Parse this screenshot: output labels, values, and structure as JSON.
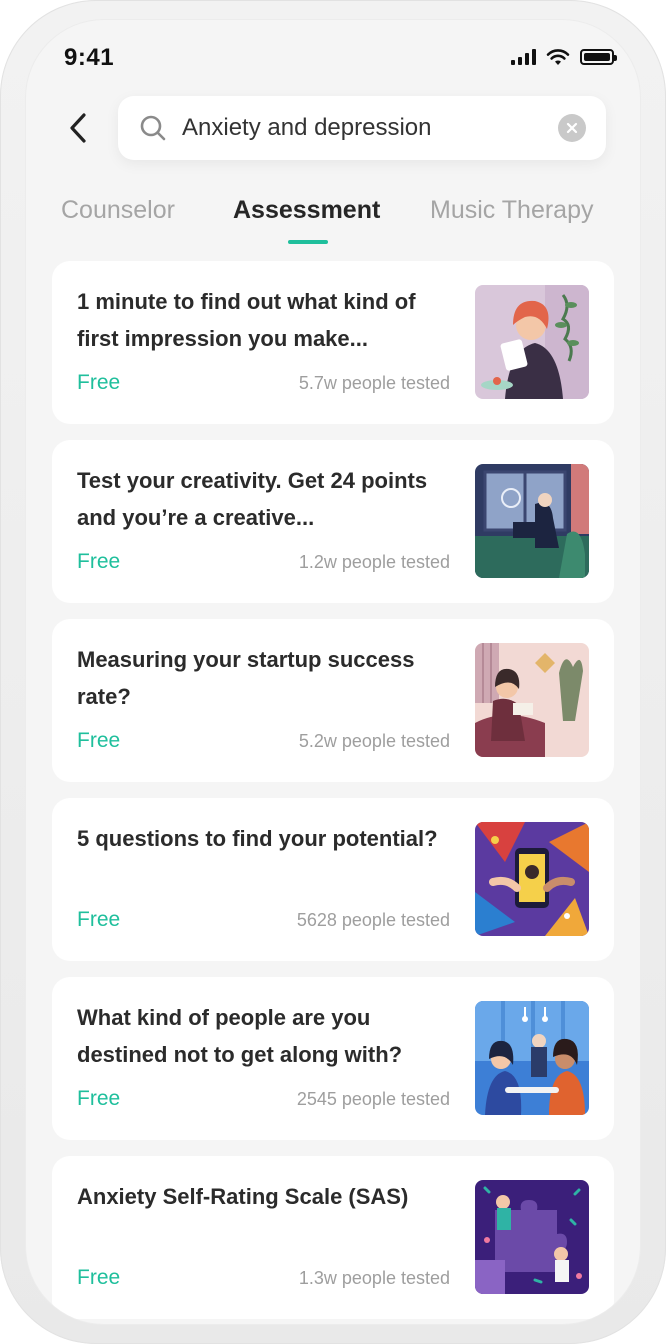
{
  "status_bar": {
    "time": "9:41"
  },
  "search": {
    "value": "Anxiety and depression"
  },
  "tabs": [
    {
      "label": "Counselor",
      "active": false
    },
    {
      "label": "Assessment",
      "active": true
    },
    {
      "label": "Music Therapy",
      "active": false
    }
  ],
  "colors": {
    "accent": "#1fbf9c",
    "muted_text": "#9e9e9e",
    "background": "#f5f5f5"
  },
  "assessments": [
    {
      "title": "1 minute to find out what kind of first impression you make...",
      "price": "Free",
      "tested": "5.7w people tested",
      "image": "woman-reading-illustration"
    },
    {
      "title": "Test your creativity. Get 24 points and you’re a creative...",
      "price": "Free",
      "tested": "1.2w people tested",
      "image": "person-at-desk-illustration"
    },
    {
      "title": "Measuring your startup success rate?",
      "price": "Free",
      "tested": "5.2w people tested",
      "image": "woman-reading-couch-illustration"
    },
    {
      "title": "5 questions to find your potential?",
      "price": "Free",
      "tested": "5628 people tested",
      "image": "hands-phone-illustration"
    },
    {
      "title": "What kind of people are you destined not to get along with?",
      "price": "Free",
      "tested": "2545 people tested",
      "image": "cafe-people-illustration"
    },
    {
      "title": "Anxiety Self-Rating Scale (SAS)",
      "price": "Free",
      "tested": "1.3w people tested",
      "image": "puzzle-people-illustration"
    }
  ]
}
